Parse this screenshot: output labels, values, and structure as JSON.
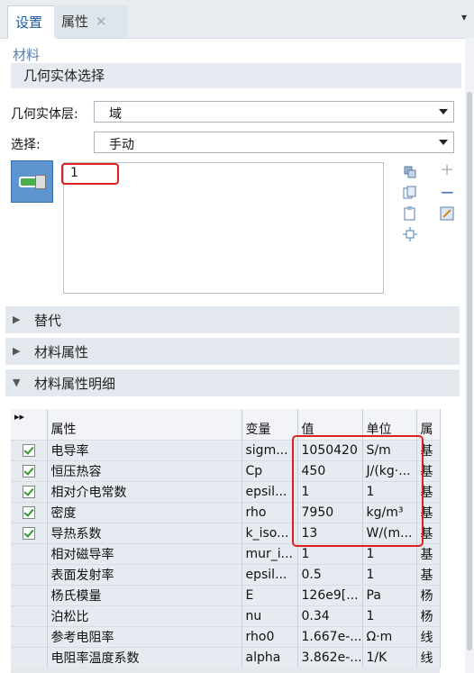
{
  "tabs": [
    {
      "label": "设置"
    },
    {
      "label": "属性",
      "close": "✕"
    }
  ],
  "pin_glyph": "▾",
  "breadcrumb": "材料",
  "geometry_section": {
    "title": "几何实体选择",
    "level_label": "几何实体层:",
    "level_value": "域",
    "selection_label": "选择:",
    "selection_value": "手动",
    "selected_item": "1"
  },
  "accordions": [
    {
      "label": "替代",
      "state": "collapsed"
    },
    {
      "label": "材料属性",
      "state": "collapsed"
    },
    {
      "label": "材料属性明细",
      "state": "expanded"
    }
  ],
  "table": {
    "expand_glyph": "▸▸",
    "headers": [
      "属性",
      "变量",
      "值",
      "单位",
      "属"
    ],
    "rows": [
      {
        "checked": true,
        "property": "电导率",
        "variable": "sigm...",
        "value": "1050420",
        "unit": "S/m",
        "extra": "基"
      },
      {
        "checked": true,
        "property": "恒压热容",
        "variable": "Cp",
        "value": "450",
        "unit": "J/(kg·...",
        "extra": "基"
      },
      {
        "checked": true,
        "property": "相对介电常数",
        "variable": "epsil...",
        "value": "1",
        "unit": "1",
        "extra": "基"
      },
      {
        "checked": true,
        "property": "密度",
        "variable": "rho",
        "value": "7950",
        "unit": "kg/m³",
        "extra": "基"
      },
      {
        "checked": true,
        "property": "导热系数",
        "variable": "k_iso...",
        "value": "13",
        "unit": "W/(m...",
        "extra": "基"
      },
      {
        "checked": false,
        "property": "相对磁导率",
        "variable": "mur_i...",
        "value": "1",
        "unit": "1",
        "extra": "基"
      },
      {
        "checked": false,
        "property": "表面发射率",
        "variable": "epsil...",
        "value": "0.5",
        "unit": "1",
        "extra": "基"
      },
      {
        "checked": false,
        "property": "杨氏模量",
        "variable": "E",
        "value": "126e9[...",
        "unit": "Pa",
        "extra": "杨"
      },
      {
        "checked": false,
        "property": "泊松比",
        "variable": "nu",
        "value": "0.34",
        "unit": "1",
        "extra": "杨"
      },
      {
        "checked": false,
        "property": "参考电阻率",
        "variable": "rho0",
        "value": "1.667e-...",
        "unit": "Ω·m",
        "extra": "线"
      },
      {
        "checked": false,
        "property": "电阻率温度系数",
        "variable": "alpha",
        "value": "3.862e-...",
        "unit": "1/K",
        "extra": "线"
      }
    ]
  },
  "colors": {
    "accent": "#5c95d0",
    "highlight": "#e02020",
    "check": "#2e9a2e"
  }
}
